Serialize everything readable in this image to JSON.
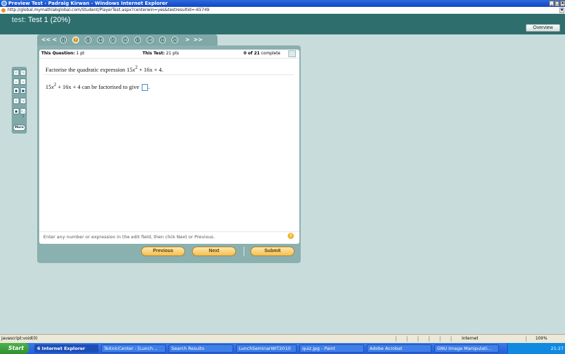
{
  "window": {
    "title": "Preview Test - Padraig Kirwan - Windows Internet Explorer"
  },
  "address": {
    "url": "http://global.mymathlabglobal.com/Student/PlayerTest.aspx?centerwin=yes&testresultid=-65749"
  },
  "header": {
    "prefix": "test:",
    "title": "Test 1 (20%)",
    "overview_label": "Overview"
  },
  "question_nav": {
    "numbers": [
      "11",
      "12",
      "13",
      "14",
      "15",
      "16",
      "17",
      "18",
      "19",
      "20"
    ],
    "current": "12",
    "first": "<<",
    "prev": "<",
    "next": ">",
    "last": ">>"
  },
  "status": {
    "question_label": "This Question:",
    "question_pts": "1 pt",
    "test_label": "This Test:",
    "test_pts": "21 pts",
    "complete": "0 of 21",
    "complete_suffix": "complete"
  },
  "question": {
    "prompt_pre": "Factorise the quadratic expression 15",
    "prompt_var": "x",
    "prompt_exp": "2",
    "prompt_post": " + 16x + 4.",
    "answer_pre": "15",
    "answer_var": "x",
    "answer_exp": "2",
    "answer_post": " + 16x + 4 can be factorised to give",
    "answer_end": "."
  },
  "hint": "Enter any number or expression in the edit field, then click Next or Previous.",
  "buttons": {
    "previous": "Previous",
    "next": "Next",
    "submit": "Submit"
  },
  "toolbox": {
    "more_label": "More"
  },
  "statusbar": {
    "left": "javascript:void(0)",
    "zone": "Internet",
    "zoom": "100%"
  },
  "taskbar": {
    "start": "Start",
    "items": [
      "6 Internet Explorer",
      "TeXnicCenter - [Lunch...",
      "Search Results",
      "LunchSeminarWIT2010",
      "quiz.jpg - Paint",
      "Adobe Acrobat",
      "GNU Image Manipulati..."
    ],
    "clock": "21:27"
  }
}
